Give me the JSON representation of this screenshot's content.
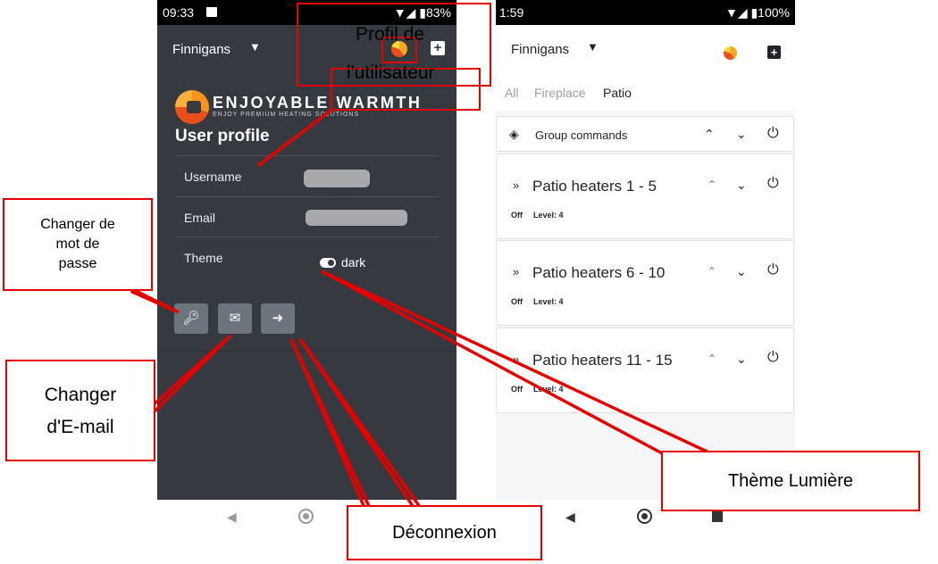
{
  "left_phone": {
    "status_bar": {
      "time": "09:33",
      "indicators": "▼◢ ▮83%"
    },
    "header": {
      "account": "Finnigans",
      "caret_icon": "caret-down-icon",
      "avatar_icon": "user-avatar-icon",
      "add_icon": "plus-square-icon"
    },
    "logo": {
      "title": "ENJOYABLE WARMTH",
      "subtitle": "ENJOY PREMIUM HEATING SOLUTIONS"
    },
    "profile": {
      "title": "User profile",
      "rows": {
        "username": {
          "label": "Username"
        },
        "email": {
          "label": "Email"
        },
        "theme": {
          "label": "Theme",
          "value": "dark"
        }
      },
      "actions": {
        "password_icon": "key-icon",
        "email_icon": "envelope-icon",
        "logout_icon": "sign-out-icon"
      }
    }
  },
  "right_phone": {
    "status_bar": {
      "time": "1:59",
      "indicators": "▼◢ ▮100%"
    },
    "header": {
      "account": "Finnigans"
    },
    "tabs": [
      "All",
      "Fireplace",
      "Patio"
    ],
    "group": {
      "label": "Group commands"
    },
    "heaters": [
      {
        "name": "Patio heaters 1 - 5",
        "status": "Off",
        "level": "Level: 4"
      },
      {
        "name": "Patio heaters 6 - 10",
        "status": "Off",
        "level": "Level: 4"
      },
      {
        "name": "Patio heaters 11 - 15",
        "status": "Off",
        "level": "Level: 4"
      }
    ]
  },
  "annotations": {
    "profile_line1": "Profil de",
    "profile_line2": "l'utilisateur",
    "password_line1": "Changer de",
    "password_line2": "mot de",
    "password_line3": "passe",
    "email_line1": "Changer",
    "email_line2": "d'E-mail",
    "logout": "Déconnexion",
    "theme": "Thème Lumière",
    "accent_color": "#e60000"
  },
  "colors": {
    "dark_bg": "#343a40",
    "button_gray": "#6c757d",
    "light_bg": "#f5f6f7"
  }
}
